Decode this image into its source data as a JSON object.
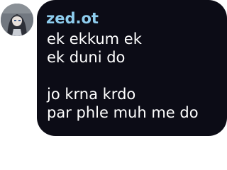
{
  "message": {
    "avatar_icon": "user-avatar-icon",
    "username": "zed.ot",
    "lines": [
      "ek ekkum ek",
      "ek duni do",
      "",
      "jo krna krdo",
      "par phle muh me do"
    ]
  },
  "colors": {
    "bubble_background": "#0c0c16",
    "username": "#8ecdee",
    "message_text": "#ffffff"
  }
}
